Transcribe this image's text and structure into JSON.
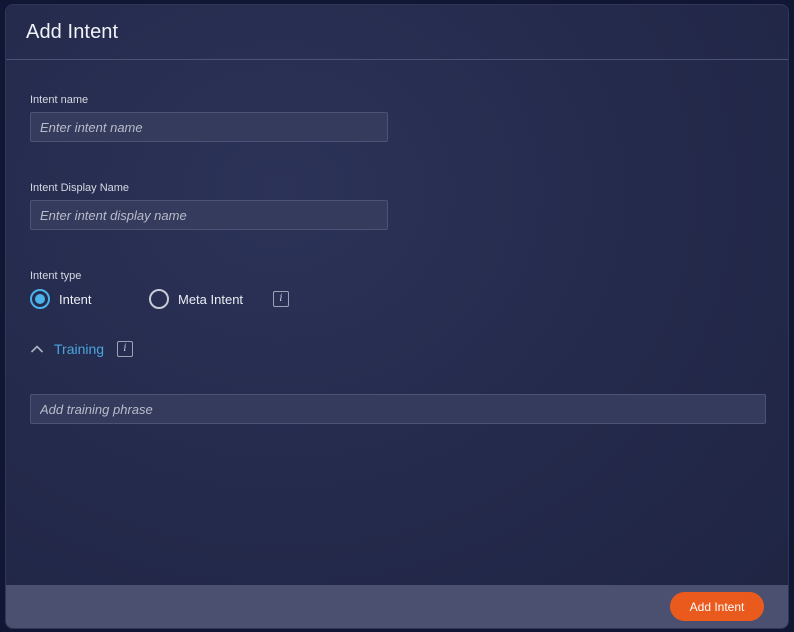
{
  "dialog": {
    "title": "Add Intent"
  },
  "form": {
    "intent_name": {
      "label": "Intent name",
      "placeholder": "Enter intent name",
      "value": ""
    },
    "display_name": {
      "label": "Intent Display Name",
      "placeholder": "Enter intent display name",
      "value": ""
    },
    "intent_type": {
      "label": "Intent type",
      "options": [
        {
          "label": "Intent",
          "selected": true
        },
        {
          "label": "Meta Intent",
          "selected": false
        }
      ],
      "info_icon": "info-icon"
    },
    "training": {
      "label": "Training",
      "expanded": true,
      "toggle_icon": "chevron-up-icon",
      "info_icon": "info-icon",
      "phrase_placeholder": "Add training phrase"
    }
  },
  "footer": {
    "submit_label": "Add Intent"
  },
  "colors": {
    "accent_blue": "#49b3ea",
    "button_orange": "#ea5a1c"
  }
}
